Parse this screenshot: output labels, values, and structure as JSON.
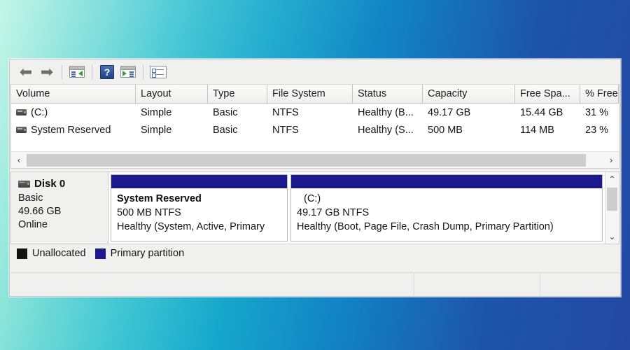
{
  "toolbar": {
    "back_label": "Back",
    "forward_label": "Forward",
    "show_hide_console_tree_label": "Show/Hide Console Tree",
    "help_label": "Help",
    "show_hide_action_pane_label": "Show/Hide Action Pane",
    "properties_label": "Properties",
    "back_glyph": "⬅",
    "forward_glyph": "➡",
    "help_glyph": "?"
  },
  "volume_list": {
    "columns": [
      "Volume",
      "Layout",
      "Type",
      "File System",
      "Status",
      "Capacity",
      "Free Spa...",
      "% Free"
    ],
    "rows": [
      {
        "volume": "(C:)",
        "layout": "Simple",
        "type": "Basic",
        "file_system": "NTFS",
        "status": "Healthy (B...",
        "capacity": "49.17 GB",
        "free_space": "15.44 GB",
        "percent_free": "31 %"
      },
      {
        "volume": "System Reserved",
        "layout": "Simple",
        "type": "Basic",
        "file_system": "NTFS",
        "status": "Healthy (S...",
        "capacity": "500 MB",
        "free_space": "114 MB",
        "percent_free": "23 %"
      }
    ],
    "hscroll_left_glyph": "‹",
    "hscroll_right_glyph": "›"
  },
  "graphical_view": {
    "disk": {
      "name": "Disk 0",
      "type": "Basic",
      "capacity": "49.66 GB",
      "status": "Online"
    },
    "partitions": [
      {
        "name": "System Reserved",
        "size_fs": "500 MB NTFS",
        "status": "Healthy (System, Active, Primary",
        "bar_color": "#1a1a8e"
      },
      {
        "name": "(C:)",
        "size_fs": "49.17 GB NTFS",
        "status": "Healthy (Boot, Page File, Crash Dump, Primary Partition)",
        "bar_color": "#1a1a8e"
      }
    ],
    "vscroll_up_glyph": "⌃",
    "vscroll_down_glyph": "⌄"
  },
  "legend": [
    {
      "label": "Unallocated",
      "color": "#111111"
    },
    {
      "label": "Primary partition",
      "color": "#1a1a8e"
    }
  ]
}
